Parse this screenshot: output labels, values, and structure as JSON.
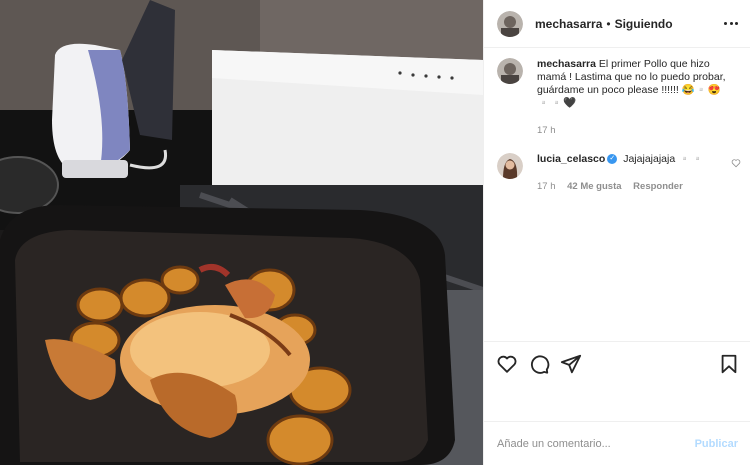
{
  "post": {
    "username": "mechasarra",
    "separator": "•",
    "follow_state": "Siguiendo"
  },
  "caption": {
    "username": "mechasarra",
    "text": "El primer Pollo que hizo mamá ! Lastima que no lo puedo probar, guárdame un poco please !!!!!! 😂▫️😍▫️▫️🖤",
    "time": "17 h"
  },
  "comments": [
    {
      "username": "lucia_celasco",
      "verified": true,
      "text": "Jajajajajaja ▫️▫️",
      "time": "17 h",
      "likes": "42 Me gusta",
      "reply": "Responder"
    }
  ],
  "composer": {
    "placeholder": "Añade un comentario...",
    "publish": "Publicar"
  },
  "icons": [
    "more-icon",
    "heart-icon",
    "comment-icon",
    "share-icon",
    "bookmark-icon",
    "verified-icon"
  ],
  "colors": {
    "link": "#3897f0",
    "publish_disabled": "#b3dbff",
    "muted": "#8e8e8e"
  }
}
